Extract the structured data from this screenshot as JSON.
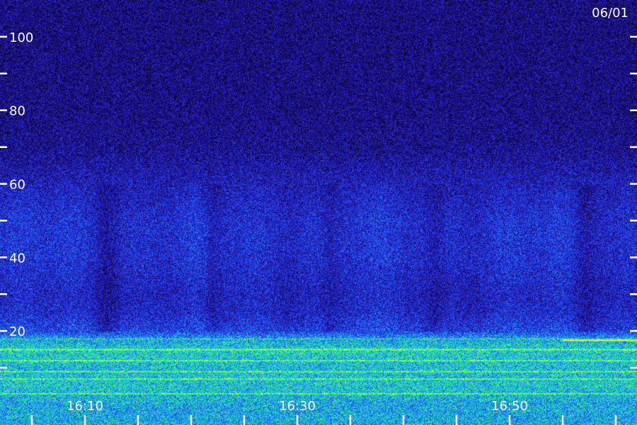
{
  "chart_data": {
    "type": "heatmap",
    "title": "",
    "xlabel": "",
    "ylabel": "",
    "date": "06/01",
    "x_range": [
      "16:02",
      "17:02"
    ],
    "ylim": [
      0,
      110
    ],
    "y_tick_labels": [
      "20",
      "40",
      "60",
      "80",
      "100"
    ],
    "y_ticks": [
      10,
      20,
      30,
      40,
      50,
      60,
      70,
      80,
      90,
      100
    ],
    "x_tick_labels": [
      "16:10",
      "16:30",
      "16:50"
    ],
    "x_ticks_minutes": [
      "16:05",
      "16:10",
      "16:15",
      "16:20",
      "16:25",
      "16:30",
      "16:35",
      "16:40",
      "16:45",
      "16:50",
      "16:55",
      "17:00"
    ],
    "colormap": [
      "#05031a",
      "#1a0b6e",
      "#2a1fd0",
      "#1f5cff",
      "#19c8e6",
      "#2fff6a",
      "#f2ff2a"
    ],
    "intensity_profile": {
      "y": [
        0,
        5,
        10,
        15,
        18,
        20,
        25,
        30,
        40,
        50,
        60,
        70,
        80,
        100,
        110
      ],
      "level": [
        0.62,
        0.68,
        0.66,
        0.7,
        0.6,
        0.42,
        0.34,
        0.32,
        0.36,
        0.36,
        0.3,
        0.22,
        0.2,
        0.19,
        0.19
      ]
    },
    "bright_lines_y": [
      3,
      7,
      9,
      12,
      15,
      18
    ],
    "quiet_columns": [
      "16:12",
      "16:22",
      "16:33",
      "16:43",
      "16:57"
    ]
  }
}
